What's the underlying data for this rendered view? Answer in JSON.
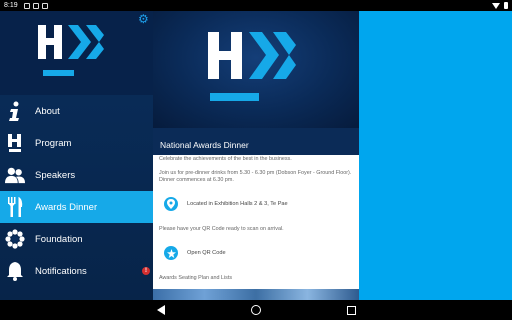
{
  "status_bar": {
    "time": "8:19"
  },
  "drawer": {
    "menu": [
      {
        "label": "About",
        "icon": "info-icon"
      },
      {
        "label": "Program",
        "icon": "program-h-icon"
      },
      {
        "label": "Speakers",
        "icon": "people-icon"
      },
      {
        "label": "Awards Dinner",
        "icon": "cutlery-icon",
        "active": true
      },
      {
        "label": "Foundation",
        "icon": "flower-icon"
      },
      {
        "label": "Notifications",
        "icon": "bell-icon",
        "badge": "!"
      }
    ]
  },
  "event": {
    "title": "National Awards Dinner",
    "description": "Celebrate the achievements of the best in the business.",
    "details": "Join us for pre-dinner drinks from 5.30 - 6.30 pm (Dobson Foyer - Ground Floor).  Dinner commences at 6.30 pm.",
    "location": "Located in Exhibition Halls 2 & 3, Te Pae",
    "qr_prompt": "Please have your QR Code ready to scan on arrival.",
    "qr_button": "Open QR Code",
    "seating": "Awards Seating Plan and Lists"
  },
  "colors": {
    "accent": "#16a9e8",
    "navy": "#0b2b57",
    "right_panel": "#00a6ee"
  }
}
